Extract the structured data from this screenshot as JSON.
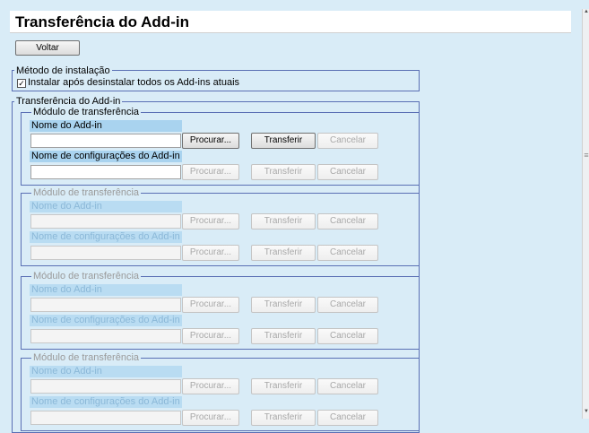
{
  "page": {
    "title": "Transferência do Add-in",
    "back_label": "Voltar"
  },
  "install_method": {
    "legend": "Método de instalação",
    "checkbox_label": "Instalar após desinstalar todos os Add-ins atuais",
    "checked": true
  },
  "transfer_group": {
    "legend": "Transferência do Add-in"
  },
  "modules": [
    {
      "legend": "Módulo de transferência",
      "enabled": true,
      "addin_name_label": "Nome do Add-in",
      "settings_name_label": "Nome de configurações do Add-in",
      "browse_label": "Procurar...",
      "transfer_label": "Transferir",
      "cancel_label": "Cancelar"
    },
    {
      "legend": "Módulo de transferência",
      "enabled": false,
      "addin_name_label": "Nome do Add-in",
      "settings_name_label": "Nome de configurações do Add-in",
      "browse_label": "Procurar...",
      "transfer_label": "Transferir",
      "cancel_label": "Cancelar"
    },
    {
      "legend": "Módulo de transferência",
      "enabled": false,
      "addin_name_label": "Nome do Add-in",
      "settings_name_label": "Nome de configurações do Add-in",
      "browse_label": "Procurar...",
      "transfer_label": "Transferir",
      "cancel_label": "Cancelar"
    },
    {
      "legend": "Módulo de transferência",
      "enabled": false,
      "addin_name_label": "Nome do Add-in",
      "settings_name_label": "Nome de configurações do Add-in",
      "browse_label": "Procurar...",
      "transfer_label": "Transferir",
      "cancel_label": "Cancelar"
    }
  ]
}
